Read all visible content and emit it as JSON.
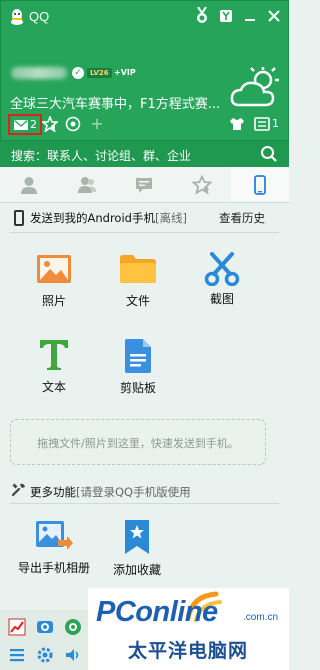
{
  "colors": {
    "brand_green": "#26a55a",
    "search_green": "#1f9850",
    "panel_bg": "#e9f2ee",
    "highlight_red": "#dd2222",
    "watermark_blue": "#1d5fb1"
  },
  "titlebar": {
    "title": "QQ"
  },
  "profile": {
    "level_badge": "LV26",
    "vip_badge": "+VIP",
    "signature": "全球三大汽车赛事中，F1方程式赛..."
  },
  "toolbar": {
    "mail_count": "2",
    "app_box_count": "1"
  },
  "search": {
    "placeholder": "搜索：联系人、讨论组、群、企业"
  },
  "tabs": [
    "contacts-icon",
    "friends-icon",
    "chat-icon",
    "favorites-icon",
    "phone-icon"
  ],
  "device_panel": {
    "title": "发送到我的Android手机",
    "status": "[离线]",
    "history": "查看历史"
  },
  "features": [
    {
      "icon": "photo-icon",
      "label": "照片"
    },
    {
      "icon": "folder-icon",
      "label": "文件"
    },
    {
      "icon": "scissors-icon",
      "label": "截图"
    },
    {
      "icon": "text-icon",
      "label": "文本"
    },
    {
      "icon": "clipboard-icon",
      "label": "剪贴板"
    }
  ],
  "dropzone": {
    "hint": "拖拽文件/照片到这里，快速发送到手机。"
  },
  "more": {
    "title": "更多功能",
    "note": "[请登录QQ手机版使用"
  },
  "extra_features": [
    {
      "icon": "export-album-icon",
      "label": "导出手机相册"
    },
    {
      "icon": "bookmark-icon",
      "label": "添加收藏"
    }
  ],
  "watermark": {
    "brand": "PConline",
    "domain": ".com.cn",
    "cn_name": "太平洋电脑网"
  }
}
